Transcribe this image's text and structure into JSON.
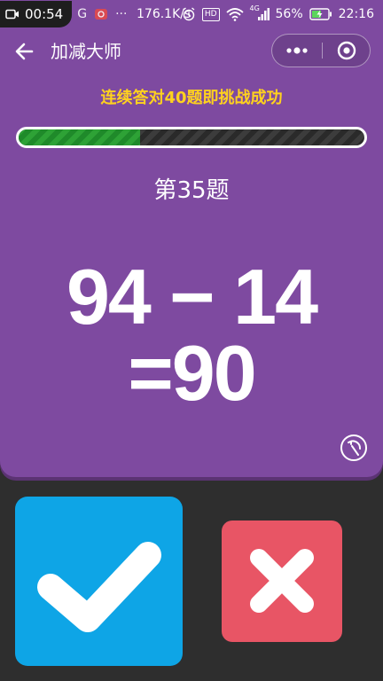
{
  "status_bar": {
    "recording_time": "00:54",
    "network_type": "G",
    "dots": "···",
    "speed": "176.1K/s",
    "hd_label": "HD",
    "signal_label": "4G",
    "battery": "56%",
    "time": "22:16"
  },
  "nav": {
    "title": "加减大师"
  },
  "challenge": {
    "text": "连续答对40题即挑战成功",
    "progress_fraction": 0.35
  },
  "question": {
    "label": "第35题",
    "expression": "94 − 14",
    "result": "=90"
  },
  "colors": {
    "panel": "#7e4aa0",
    "challenge_text": "#ffd21e",
    "progress_fill": "#2ea236",
    "correct_button": "#0ea5e6",
    "wrong_button": "#e85565"
  },
  "icons": {
    "back": "arrow-left-icon",
    "more": "more-dots-icon",
    "close": "target-circle-icon",
    "refresh": "refresh-icon",
    "correct": "checkmark-icon",
    "wrong": "cross-icon"
  }
}
